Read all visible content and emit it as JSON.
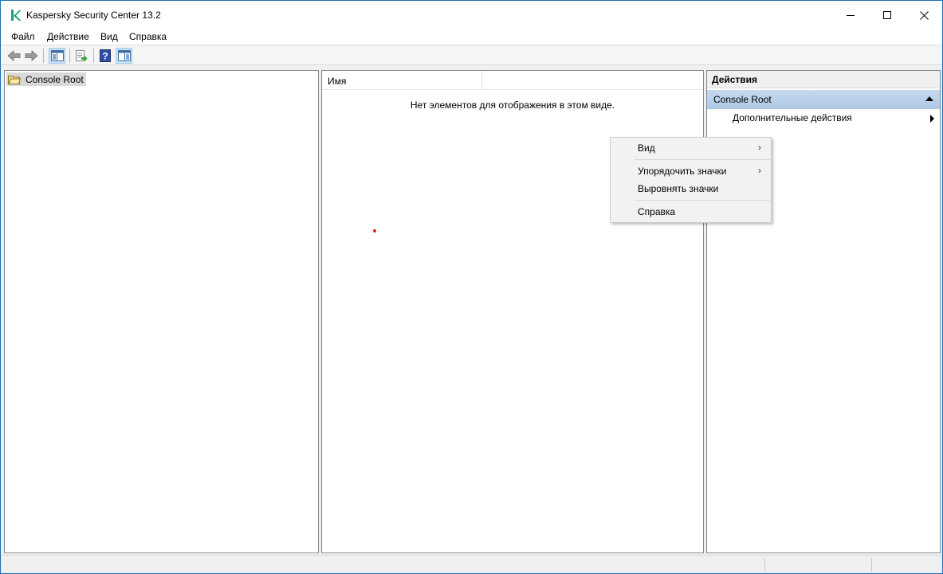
{
  "window": {
    "title": "Kaspersky Security Center 13.2",
    "logo_color": "#1aa37a"
  },
  "menubar": {
    "items": [
      "Файл",
      "Действие",
      "Вид",
      "Справка"
    ]
  },
  "toolbar": {
    "buttons": [
      "back-icon",
      "forward-icon",
      "show-hide-console-tree-icon",
      "export-list-icon",
      "help-icon",
      "show-hide-action-pane-icon"
    ]
  },
  "tree": {
    "root_label": "Console Root"
  },
  "result_pane": {
    "column_name": "Имя",
    "empty_message": "Нет элементов для отображения в этом виде."
  },
  "actions_pane": {
    "header": "Действия",
    "section_title": "Console Root",
    "items": [
      "Дополнительные действия"
    ]
  },
  "context_menu": {
    "items": [
      {
        "label": "Вид",
        "submenu": true
      },
      {
        "label": "Упорядочить значки",
        "submenu": true
      },
      {
        "label": "Выровнять значки",
        "submenu": false
      },
      {
        "label": "Справка",
        "submenu": false
      }
    ],
    "submenu_glyph": "›"
  }
}
